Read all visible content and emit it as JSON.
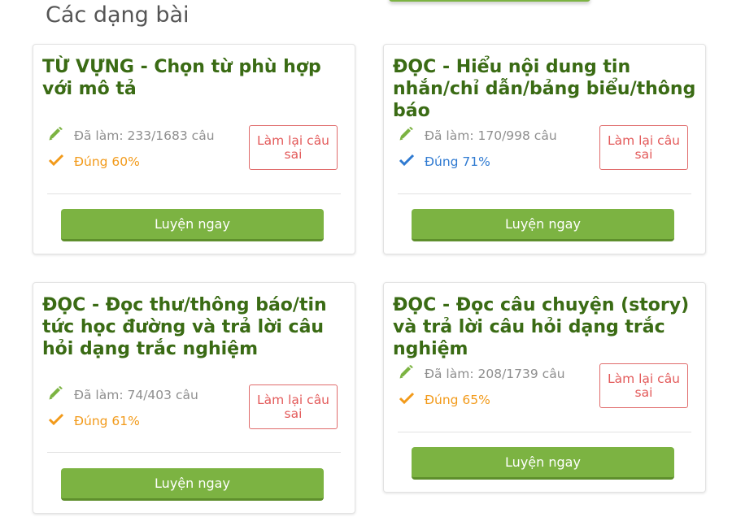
{
  "section": {
    "title": "Các dạng bài"
  },
  "colors": {
    "green": "#7cb342",
    "title_green": "#3a6b14",
    "orange": "#f29a1a",
    "blue": "#2f7ad1",
    "red": "#e35a5a"
  },
  "icons": {
    "done": "pencil-icon",
    "correct": "checkmark-icon"
  },
  "cards": [
    {
      "title": "TỪ VỰNG - Chọn từ phù hợp với mô tả",
      "done": "Đã làm: 233/1683 câu",
      "correct": "Đúng 60%",
      "redo": "Làm lại câu sai",
      "practice": "Luyện ngay"
    },
    {
      "title": "ĐỌC - Hiểu nội dung tin nhắn/chỉ dẫn/bảng biểu/thông báo",
      "done": "Đã làm: 170/998 câu",
      "correct": "Đúng 71%",
      "redo": "Làm lại câu sai",
      "practice": "Luyện ngay"
    },
    {
      "title": "ĐỌC - Đọc thư/thông báo/tin tức học đường và trả lời câu hỏi dạng trắc nghiệm",
      "done": "Đã làm: 74/403 câu",
      "correct": "Đúng 61%",
      "redo": "Làm lại câu sai",
      "practice": "Luyện ngay"
    },
    {
      "title": "ĐỌC - Đọc câu chuyện (story) và trả lời câu hỏi dạng trắc nghiệm",
      "done": "Đã làm: 208/1739 câu",
      "correct": "Đúng 65%",
      "redo": "Làm lại câu sai",
      "practice": "Luyện ngay"
    }
  ]
}
